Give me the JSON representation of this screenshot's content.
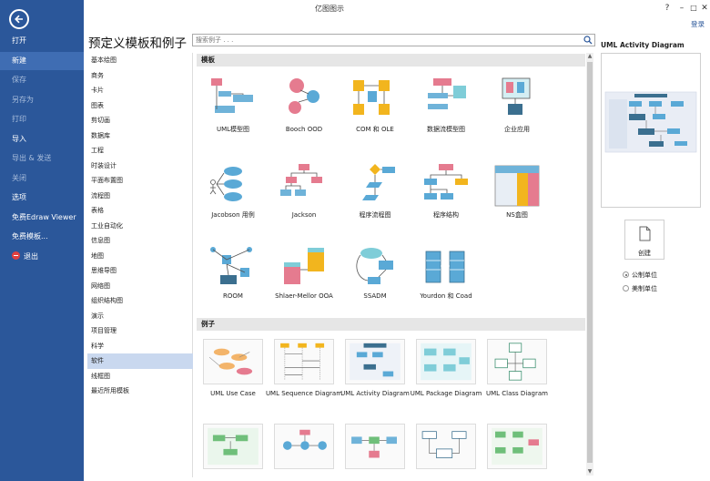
{
  "window": {
    "title": "亿图图示",
    "login": "登录"
  },
  "nav": {
    "items": [
      {
        "label": "打开",
        "state": "normal"
      },
      {
        "label": "新建",
        "state": "active"
      },
      {
        "label": "保存",
        "state": "muted"
      },
      {
        "label": "另存为",
        "state": "muted"
      },
      {
        "label": "打印",
        "state": "muted"
      },
      {
        "label": "导入",
        "state": "normal"
      },
      {
        "label": "导出 & 发送",
        "state": "muted"
      },
      {
        "label": "关闭",
        "state": "muted"
      },
      {
        "label": "选项",
        "state": "normal"
      },
      {
        "label": "免费Edraw Viewer",
        "state": "normal"
      },
      {
        "label": "免费模板...",
        "state": "normal"
      },
      {
        "label": "退出",
        "state": "normal"
      }
    ]
  },
  "main": {
    "heading": "预定义模板和例子",
    "search_placeholder": "搜索例子 . . ."
  },
  "categories": [
    "基本绘图",
    "商务",
    "卡片",
    "图表",
    "剪切画",
    "数据库",
    "工程",
    "时装设计",
    "平面布置图",
    "流程图",
    "表格",
    "工业自动化",
    "信息图",
    "地图",
    "思维导图",
    "网络图",
    "组织结构图",
    "演示",
    "项目管理",
    "科学",
    "软件",
    "线框图",
    "最近所用模板"
  ],
  "selected_category": "软件",
  "templates_section": "模板",
  "templates": [
    "UML模型图",
    "Booch OOD",
    "COM 和 OLE",
    "数据流模型图",
    "企业应用",
    "Jacobson 用例",
    "Jackson",
    "程序流程图",
    "程序结构",
    "NS盒图",
    "ROOM",
    "Shlaer-Mellor OOA",
    "SSADM",
    "Yourdon 和 Coad"
  ],
  "examples_section": "例子",
  "examples": [
    "UML Use Case",
    "UML Sequence Diagram",
    "UML Activity Diagram",
    "UML Package Diagram",
    "UML Class Diagram",
    "",
    "",
    "",
    "",
    ""
  ],
  "preview": {
    "title": "UML Activity Diagram",
    "create": "创建",
    "units": [
      {
        "label": "公制单位",
        "selected": true
      },
      {
        "label": "美制单位",
        "selected": false
      }
    ]
  },
  "colors": {
    "nav_bg": "#2b579a",
    "nav_active": "#3f6db3",
    "category_active": "#c9d8ef",
    "section_header": "#e6e6e6"
  }
}
